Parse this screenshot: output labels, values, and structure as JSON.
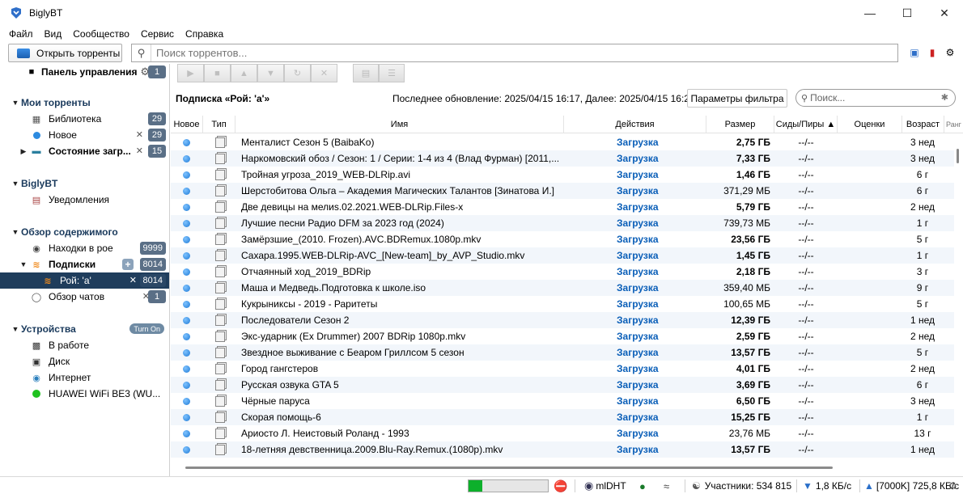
{
  "window": {
    "title": "BiglyBT"
  },
  "menu": [
    "Файл",
    "Вид",
    "Сообщество",
    "Сервис",
    "Справка"
  ],
  "toolbar": {
    "open_label": "Открыть торренты",
    "search_placeholder": "Поиск торрентов..."
  },
  "sidebar": {
    "dashboard": {
      "label": "Панель управления",
      "count": "1"
    },
    "my_torrents": {
      "header": "Мои торренты",
      "library": {
        "label": "Библиотека",
        "count": "29"
      },
      "new": {
        "label": "Новое",
        "count": "29"
      },
      "downloads": {
        "label": "Состояние загр...",
        "count": "15"
      }
    },
    "biglybt": {
      "header": "BiglyBT",
      "notifications": "Уведомления"
    },
    "content": {
      "header": "Обзор содержимого",
      "swarm": {
        "label": "Находки в рое",
        "count": "9999"
      },
      "subs": {
        "label": "Подписки",
        "count": "8014"
      },
      "swarm_a": {
        "label": "Рой: 'a'",
        "count": "8014"
      },
      "chats": {
        "label": "Обзор чатов",
        "count": "1"
      }
    },
    "devices": {
      "header": "Устройства",
      "turn_on": "Turn On",
      "working": "В работе",
      "disk": "Диск",
      "internet": "Интернет",
      "wifi": "HUAWEI WiFi BE3 (WU..."
    }
  },
  "main": {
    "subtitle": "Подписка «Рой: 'a'»",
    "last_update": "Последнее обновление: 2025/04/15 16:17, Далее: 2025/04/15 16:22",
    "filter_button": "Параметры фильтра",
    "filter_search_placeholder": "Поиск...",
    "columns": {
      "new": "Новое",
      "type": "Тип",
      "name": "Имя",
      "actions": "Действия",
      "size": "Размер",
      "seeds": "Сиды/Пиры ▲",
      "ratings": "Оценки",
      "age": "Возраст",
      "rank": "Ранг"
    },
    "rows": [
      {
        "name": "Менталист Сезон 5 (BaibaKo)",
        "action": "Загрузка",
        "size": "2,75 ГБ",
        "bold": true,
        "seeds": "--/--",
        "age": "3 нед"
      },
      {
        "name": "Наркомовский обоз / Сезон: 1 / Серии: 1-4 из 4 (Влад Фурман) [2011,...",
        "action": "Загрузка",
        "size": "7,33 ГБ",
        "bold": true,
        "seeds": "--/--",
        "age": "3 нед"
      },
      {
        "name": "Тройная угроза_2019_WEB-DLRip.avi",
        "action": "Загрузка",
        "size": "1,46 ГБ",
        "bold": true,
        "seeds": "--/--",
        "age": "6 г"
      },
      {
        "name": "Шерстобитова Ольга – Академия Магических Талантов [Зинатова И.]",
        "action": "Загрузка",
        "size": "371,29 МБ",
        "bold": false,
        "seeds": "--/--",
        "age": "6 г"
      },
      {
        "name": "Две девицы на мелиs.02.2021.WEB-DLRip.Files-x",
        "action": "Загрузка",
        "size": "5,79 ГБ",
        "bold": true,
        "seeds": "--/--",
        "age": "2 нед"
      },
      {
        "name": "Лучшие песни Радио DFM за 2023 год (2024)",
        "action": "Загрузка",
        "size": "739,73 МБ",
        "bold": false,
        "seeds": "--/--",
        "age": "1 г"
      },
      {
        "name": "Замёрзшие_(2010. Frozen).AVC.BDRemux.1080p.mkv",
        "action": "Загрузка",
        "size": "23,56 ГБ",
        "bold": true,
        "seeds": "--/--",
        "age": "5 г"
      },
      {
        "name": "Сахара.1995.WEB-DLRip-AVC_[New-team]_by_AVP_Studio.mkv",
        "action": "Загрузка",
        "size": "1,45 ГБ",
        "bold": true,
        "seeds": "--/--",
        "age": "1 г"
      },
      {
        "name": "Отчаянный ход_2019_BDRip",
        "action": "Загрузка",
        "size": "2,18 ГБ",
        "bold": true,
        "seeds": "--/--",
        "age": "3 г"
      },
      {
        "name": "Маша и Медведь.Подготовка к школе.iso",
        "action": "Загрузка",
        "size": "359,40 МБ",
        "bold": false,
        "seeds": "--/--",
        "age": "9 г"
      },
      {
        "name": "Кукрыниксы - 2019 - Раритеты",
        "action": "Загрузка",
        "size": "100,65 МБ",
        "bold": false,
        "seeds": "--/--",
        "age": "5 г"
      },
      {
        "name": "Последователи Сезон 2",
        "action": "Загрузка",
        "size": "12,39 ГБ",
        "bold": true,
        "seeds": "--/--",
        "age": "1 нед"
      },
      {
        "name": "Экс-ударник (Ex Drummer) 2007 BDRip 1080p.mkv",
        "action": "Загрузка",
        "size": "2,59 ГБ",
        "bold": true,
        "seeds": "--/--",
        "age": "2 нед"
      },
      {
        "name": "Звездное выживание с Беаром Гриллсом 5 сезон",
        "action": "Загрузка",
        "size": "13,57 ГБ",
        "bold": true,
        "seeds": "--/--",
        "age": "5 г"
      },
      {
        "name": "Город гангстеров",
        "action": "Загрузка",
        "size": "4,01 ГБ",
        "bold": true,
        "seeds": "--/--",
        "age": "2 нед"
      },
      {
        "name": "Русская озвука GTA 5",
        "action": "Загрузка",
        "size": "3,69 ГБ",
        "bold": true,
        "seeds": "--/--",
        "age": "6 г"
      },
      {
        "name": "Чёрные паруса",
        "action": "Загрузка",
        "size": "6,50 ГБ",
        "bold": true,
        "seeds": "--/--",
        "age": "3 нед"
      },
      {
        "name": "Скорая помощь-6",
        "action": "Загрузка",
        "size": "15,25 ГБ",
        "bold": true,
        "seeds": "--/--",
        "age": "1 г"
      },
      {
        "name": "Ариосто Л. Неистовый Роланд - 1993",
        "action": "Загрузка",
        "size": "23,76 МБ",
        "bold": false,
        "seeds": "--/--",
        "age": "13 г"
      },
      {
        "name": "18-летняя девственница.2009.Blu-Ray.Remux.(1080p).mkv",
        "action": "Загрузка",
        "size": "13,57 ГБ",
        "bold": true,
        "seeds": "--/--",
        "age": "1 нед"
      }
    ]
  },
  "status": {
    "dht": "mlDHT",
    "peers": "Участники: 534 815",
    "down": "1,8 КБ/с",
    "up": "[7000K] 725,8 КБ/с",
    "progress": 0.17
  }
}
